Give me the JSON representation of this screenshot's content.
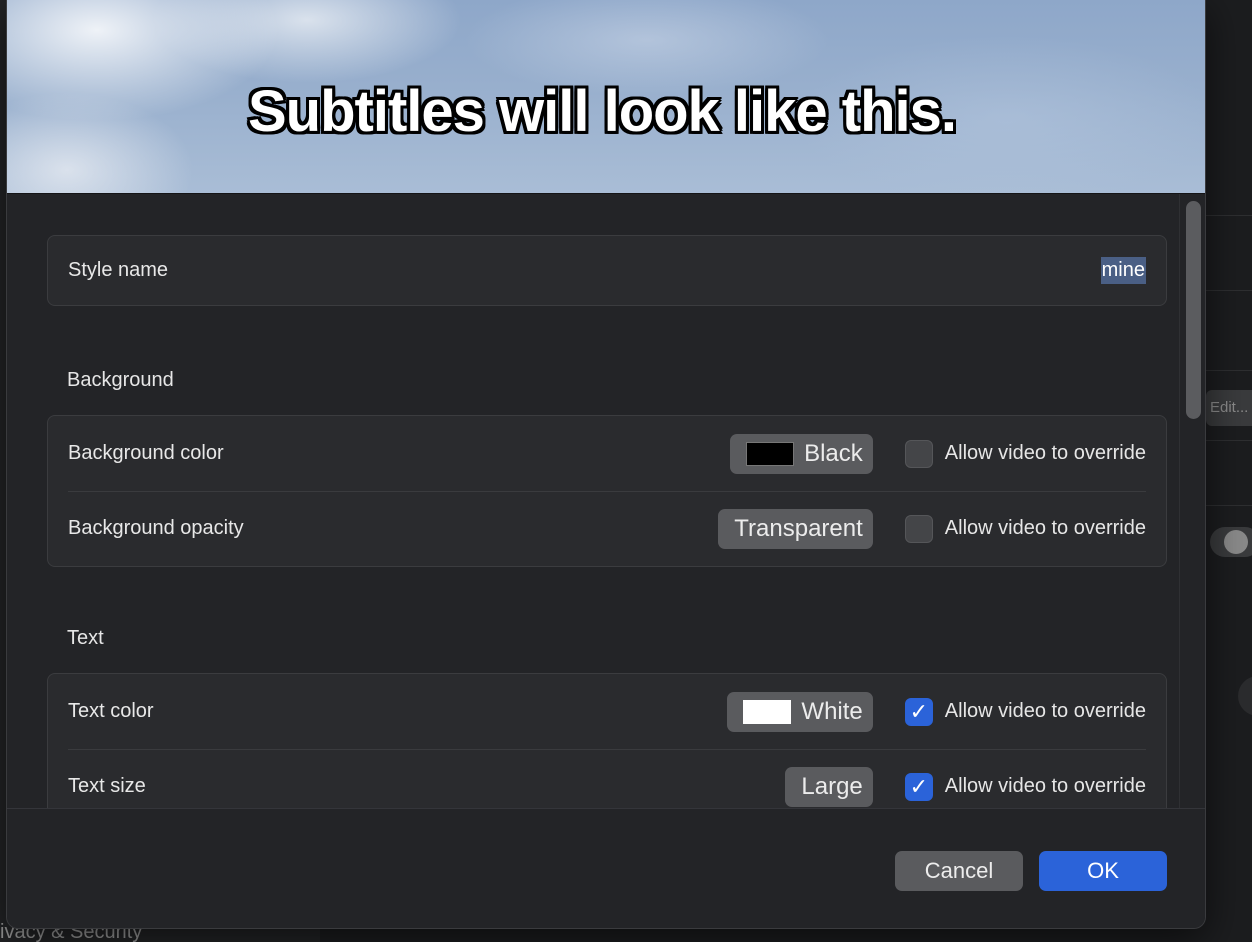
{
  "preview": {
    "sample_text": "Subtitles will look like this."
  },
  "style_name": {
    "label": "Style name",
    "value": "mine"
  },
  "background": {
    "section_title": "Background",
    "color": {
      "label": "Background color",
      "value": "Black",
      "swatch": "#000000",
      "override_label": "Allow video to override",
      "override_checked": false
    },
    "opacity": {
      "label": "Background opacity",
      "value": "Transparent",
      "override_label": "Allow video to override",
      "override_checked": false
    }
  },
  "text": {
    "section_title": "Text",
    "color": {
      "label": "Text color",
      "value": "White",
      "swatch": "#ffffff",
      "override_label": "Allow video to override",
      "override_checked": true
    },
    "size": {
      "label": "Text size",
      "value": "Large",
      "override_label": "Allow video to override",
      "override_checked": true
    }
  },
  "footer": {
    "cancel_label": "Cancel",
    "ok_label": "OK"
  },
  "background_window": {
    "edit_button_label": "Edit...",
    "sidebar_footer_text": "ivacy & Security"
  },
  "colors": {
    "accent": "#2b63d9",
    "sheet_bg": "#232427",
    "group_bg": "#2a2b2e",
    "popup_bg": "#5a5b5e"
  }
}
